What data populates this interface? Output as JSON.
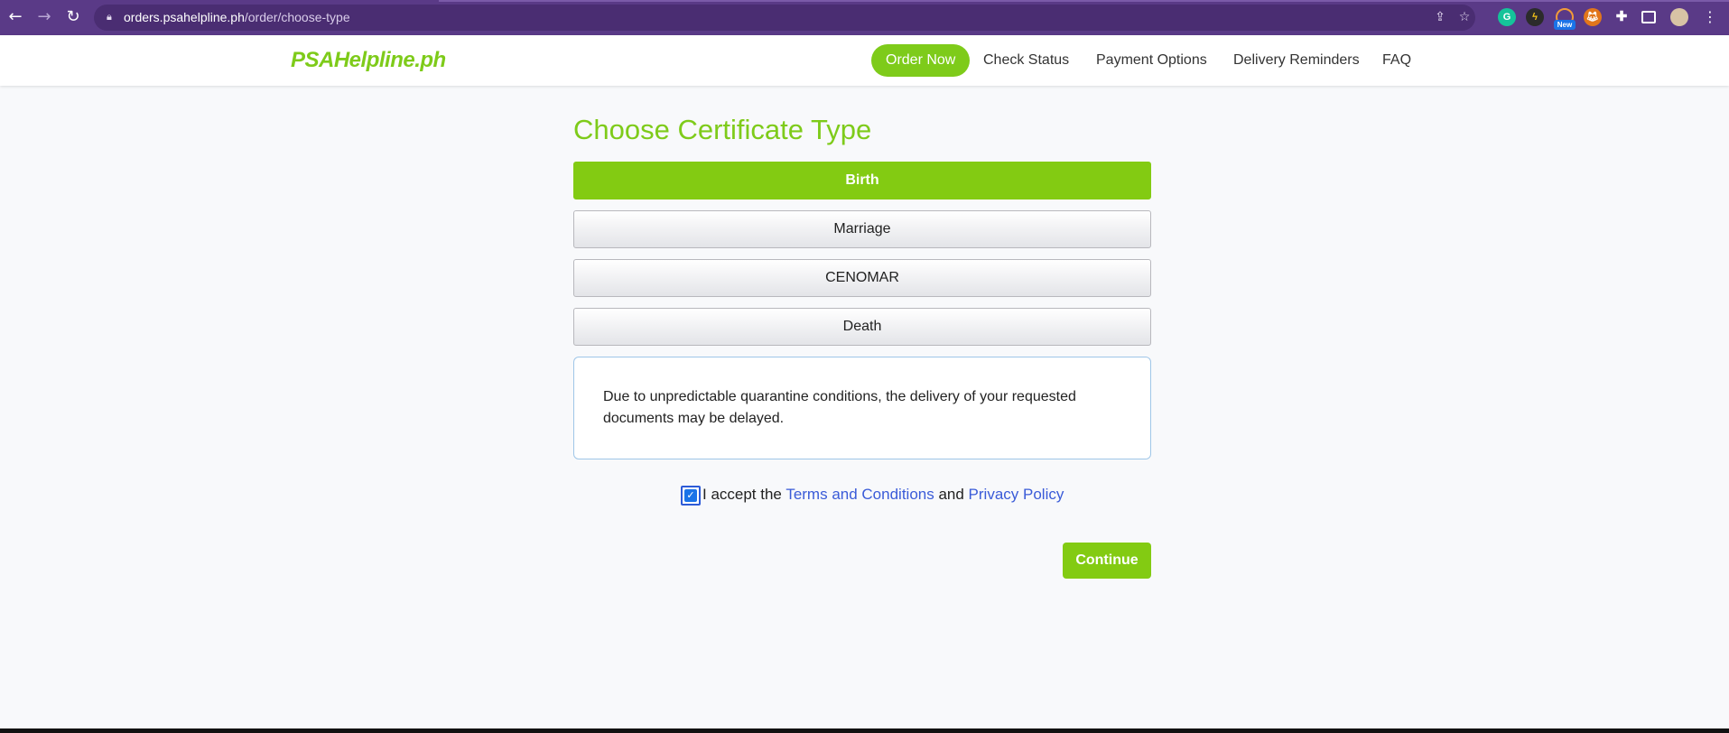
{
  "browser": {
    "url_host": "orders.psahelpline.ph",
    "url_path": "/order/choose-type",
    "back_icon": "arrow-left",
    "forward_icon": "arrow-right",
    "reload_icon": "reload",
    "extension_badge": "New"
  },
  "header": {
    "logo": "PSAHelpline.ph",
    "nav": [
      {
        "label": "Order Now",
        "active": true
      },
      {
        "label": "Check Status"
      },
      {
        "label": "Payment Options"
      },
      {
        "label": "Delivery Reminders"
      },
      {
        "label": "FAQ"
      }
    ]
  },
  "main": {
    "title": "Choose Certificate Type",
    "types": [
      {
        "label": "Birth",
        "selected": true
      },
      {
        "label": "Marriage"
      },
      {
        "label": "CENOMAR"
      },
      {
        "label": "Death"
      }
    ],
    "notice": "Due to unpredictable quarantine conditions, the delivery of your requested documents may be delayed.",
    "accept": {
      "checked": true,
      "prefix": "I accept the ",
      "terms": "Terms and Conditions",
      "middle": " and ",
      "privacy": "Privacy Policy"
    },
    "continue_label": "Continue"
  },
  "colors": {
    "chrome": "#5a3a87",
    "brand_green": "#7ecb1a",
    "link_blue": "#3a5bd8"
  }
}
